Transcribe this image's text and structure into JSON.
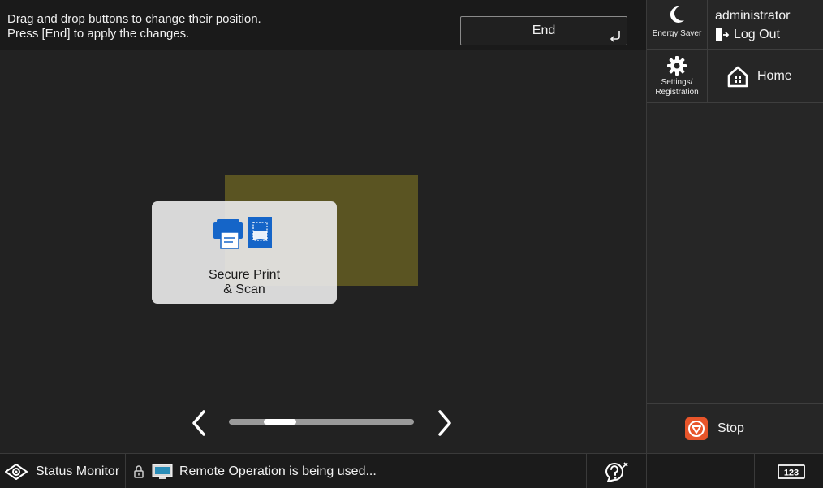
{
  "header": {
    "instruction_line1": "Drag and drop buttons to change their position.",
    "instruction_line2": "Press [End] to apply the changes.",
    "end_label": "End"
  },
  "main": {
    "tile": {
      "label": "Secure Print\n& Scan",
      "icon": "printer-scan-icon"
    },
    "pager": {
      "prev_icon": "chevron-left-icon",
      "next_icon": "chevron-right-icon"
    }
  },
  "sidebar": {
    "energy_saver_label": "Energy Saver",
    "user_name": "administrator",
    "logout_label": "Log Out",
    "settings_label": "Settings/\nRegistration",
    "home_label": "Home",
    "stop_label": "Stop"
  },
  "statusbar": {
    "status_monitor_label": "Status Monitor",
    "remote_message": "Remote Operation is being used...",
    "counter_icon": "123-counter-icon"
  },
  "colors": {
    "drop_highlight": "#5a5422",
    "tile_background": "#e8e8e8",
    "accent_blue": "#1565c8",
    "stop_orange": "#e8552a"
  }
}
